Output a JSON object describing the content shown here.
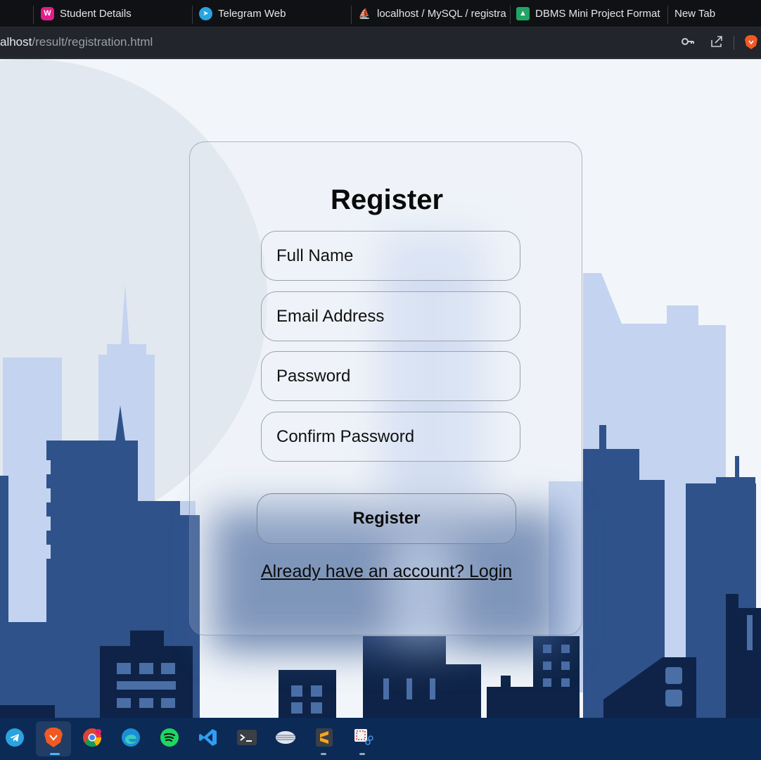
{
  "browser": {
    "tabs": [
      {
        "label": "Student Details",
        "icon": "w3-icon"
      },
      {
        "label": "Telegram Web",
        "icon": "telegram-icon"
      },
      {
        "label": "localhost / MySQL / registra",
        "icon": "phpmyadmin-icon"
      },
      {
        "label": "DBMS Mini Project Format",
        "icon": "google-classroom-icon"
      },
      {
        "label": "New Tab",
        "icon": ""
      }
    ],
    "address": {
      "host": "alhost",
      "path": "/result/registration.html"
    },
    "toolbar_icons": [
      "key-icon",
      "share-icon",
      "brave-lion-icon"
    ]
  },
  "form": {
    "title": "Register",
    "full_name_placeholder": "Full Name",
    "email_placeholder": "Email Address",
    "password_placeholder": "Password",
    "confirm_password_placeholder": "Confirm Password",
    "submit_label": "Register",
    "login_link": "Already have an account? Login"
  },
  "taskbar": {
    "apps": [
      "telegram-icon",
      "brave-icon",
      "chrome-icon",
      "edge-icon",
      "spotify-icon",
      "vscode-icon",
      "terminal-icon",
      "database-icon",
      "sublime-text-icon",
      "snipping-tool-icon"
    ],
    "active_app": "brave-icon"
  },
  "colors": {
    "sky": "#f2f6fa",
    "city_back": "#c4d3ef",
    "city_mid": "#2f528b",
    "city_front": "#0e2347",
    "taskbar": "#0b2a56"
  }
}
